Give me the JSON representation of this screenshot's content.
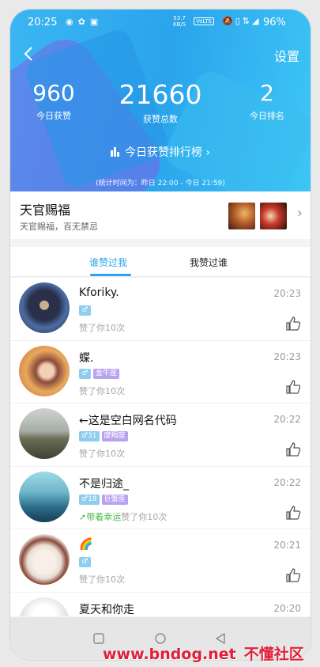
{
  "status_bar": {
    "time": "20:25",
    "net_speed_value": "53.7",
    "net_speed_unit": "KB/S",
    "volte": "VoLTE",
    "battery": "96%"
  },
  "header": {
    "settings_label": "设置",
    "stats": [
      {
        "value": "960",
        "label": "今日获赞"
      },
      {
        "value": "21660",
        "label": "获赞总数"
      },
      {
        "value": "2",
        "label": "今日排名"
      }
    ],
    "rank_link": "今日获赞排行榜 ›",
    "period": "(统计时间为：昨日 22:00 - 今日 21:59)"
  },
  "group": {
    "name": "天官赐福",
    "desc": "天官赐福，百无禁忌"
  },
  "tabs": [
    {
      "label": "谁赞过我",
      "active": true
    },
    {
      "label": "我赞过谁",
      "active": false
    }
  ],
  "likes": [
    {
      "name": "Kforiky.",
      "time": "20:23",
      "age": "",
      "zodiac": "",
      "luck": "",
      "action": "赞了你10次"
    },
    {
      "name": "蝶.",
      "time": "20:23",
      "age": "",
      "zodiac": "金牛座",
      "luck": "",
      "action": "赞了你10次"
    },
    {
      "name": "←这是空白网名代码",
      "time": "20:22",
      "age": "31",
      "zodiac": "摩羯座",
      "luck": "",
      "action": "赞了你10次"
    },
    {
      "name": "不是归途_",
      "time": "20:22",
      "age": "18",
      "zodiac": "巨蟹座",
      "luck": "带着幸运",
      "action": "赞了你10次"
    },
    {
      "name": "🌈",
      "time": "20:21",
      "age": "",
      "zodiac": "",
      "luck": "",
      "action": "赞了你10次"
    },
    {
      "name": "夏天和你走",
      "time": "20:20",
      "age": "",
      "zodiac": "",
      "luck": "",
      "action": ""
    }
  ],
  "watermark": {
    "url": "www.bndog.net",
    "cn": "不懂社区"
  },
  "colors": {
    "accent": "#2aa4ec",
    "zodiac_badge": "#b9a3f0",
    "gender_badge": "#8fcdf0",
    "luck": "#49b84b"
  }
}
